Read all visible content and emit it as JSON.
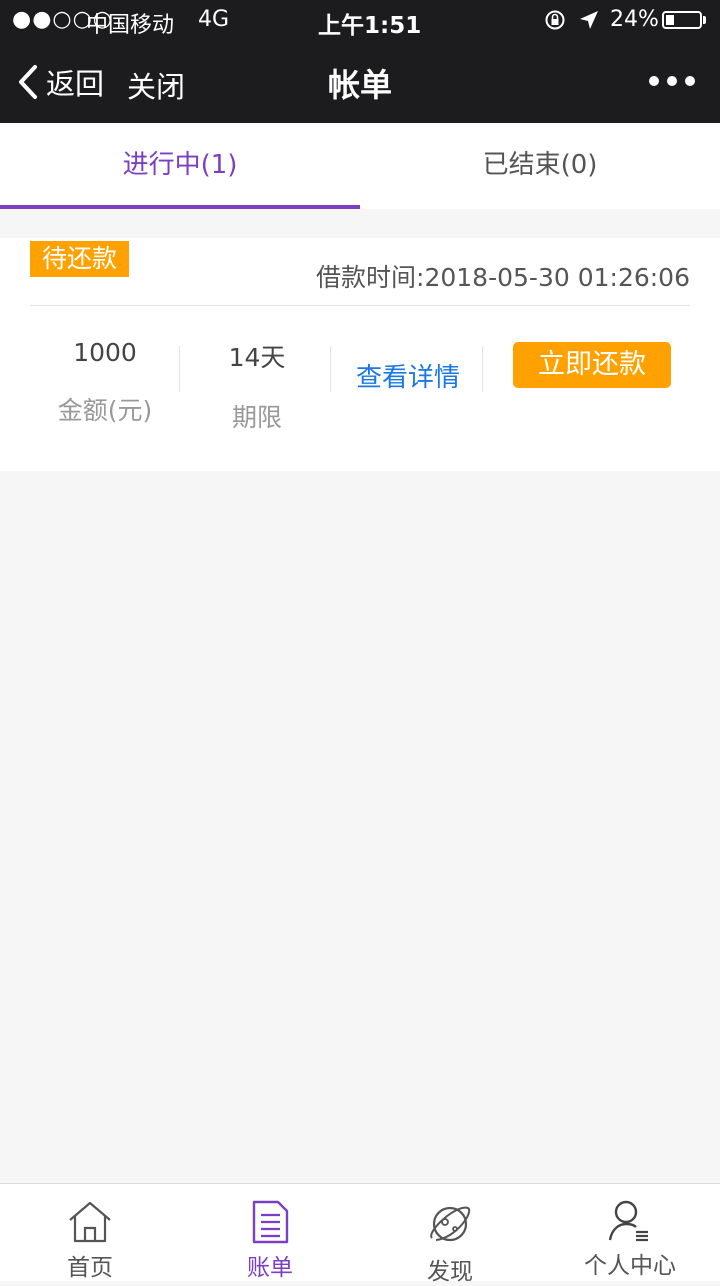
{
  "status_bar": {
    "signal": "●●○○○",
    "carrier": "中国移动",
    "network": "4G",
    "time": "上午1:51",
    "battery_percent": "24%",
    "battery_level": 0.24
  },
  "nav": {
    "back_label": "返回",
    "close_label": "关闭",
    "title": "帐单",
    "more_icon": "more-dots-icon"
  },
  "tabs": [
    {
      "label": "进行中(1)",
      "active": true
    },
    {
      "label": "已结束(0)",
      "active": false
    }
  ],
  "bill": {
    "status": "待还款",
    "loan_time": "借款时间:2018-05-30 01:26:06",
    "amount_value": "1000",
    "amount_label": "金额(元)",
    "term_value": "14天",
    "term_label": "期限",
    "detail_link": "查看详情",
    "repay_button": "立即还款"
  },
  "bottom_nav": [
    {
      "label": "首页",
      "icon": "home-icon",
      "active": false
    },
    {
      "label": "账单",
      "icon": "bill-icon",
      "active": true
    },
    {
      "label": "发现",
      "icon": "planet-icon",
      "active": false
    },
    {
      "label": "个人中心",
      "icon": "user-icon",
      "active": false
    }
  ],
  "colors": {
    "accent": "#7b3fc4",
    "warning": "#ffa100",
    "link": "#1a78e6",
    "header_bg": "#1c1c1e"
  }
}
